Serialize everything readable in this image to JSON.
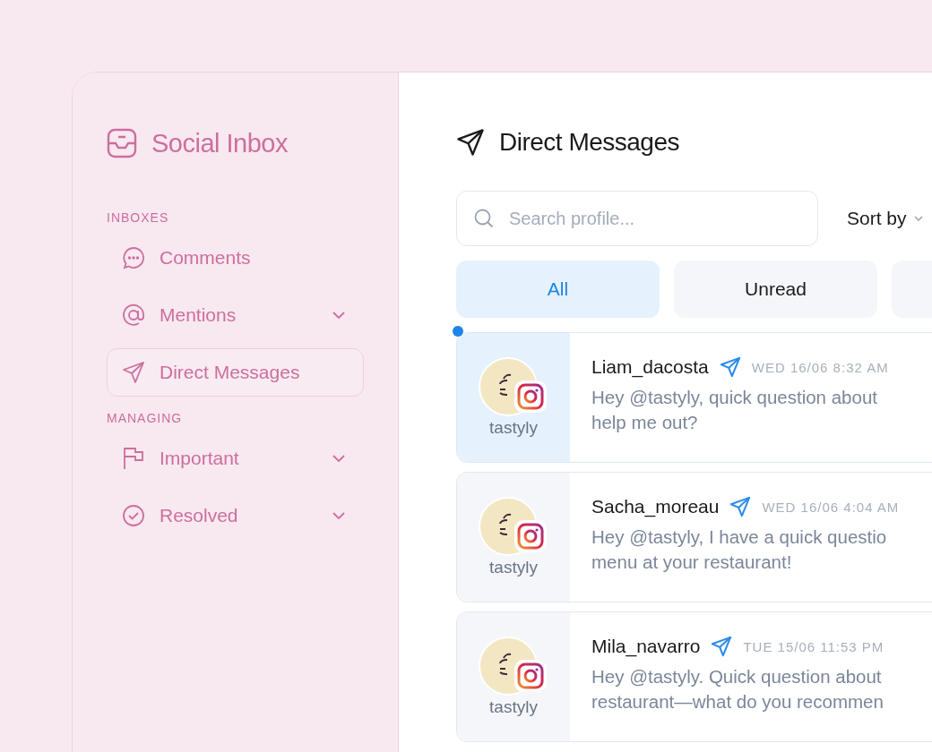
{
  "sidebar": {
    "title": "Social Inbox",
    "sections": [
      {
        "heading": "INBOXES",
        "items": [
          {
            "label": "Comments",
            "expandable": false,
            "selected": false
          },
          {
            "label": "Mentions",
            "expandable": true,
            "selected": false
          },
          {
            "label": "Direct Messages",
            "expandable": false,
            "selected": true
          }
        ]
      },
      {
        "heading": "MANAGING",
        "items": [
          {
            "label": "Important",
            "expandable": true,
            "selected": false
          },
          {
            "label": "Resolved",
            "expandable": true,
            "selected": false
          }
        ]
      }
    ]
  },
  "main": {
    "title": "Direct Messages",
    "search": {
      "placeholder": "Search profile..."
    },
    "sort": {
      "label": "Sort by"
    },
    "tabs": [
      {
        "label": "All",
        "selected": true
      },
      {
        "label": "Unread",
        "selected": false
      }
    ],
    "messages": [
      {
        "account": "tastyly",
        "sender": "Liam_dacosta",
        "time": "WED 16/06 8:32 AM",
        "lines": [
          "Hey @tastyly, quick question about",
          "help me out?"
        ],
        "unread": true
      },
      {
        "account": "tastyly",
        "sender": "Sacha_moreau",
        "time": "WED 16/06 4:04 AM",
        "lines": [
          "Hey @tastyly, I have a quick questio",
          "menu at your restaurant!"
        ],
        "unread": false
      },
      {
        "account": "tastyly",
        "sender": "Mila_navarro",
        "time": "TUE 15/06 11:53 PM",
        "lines": [
          "Hey @tastyly. Quick question about",
          "restaurant—what do you recommen"
        ],
        "unread": false
      }
    ]
  }
}
